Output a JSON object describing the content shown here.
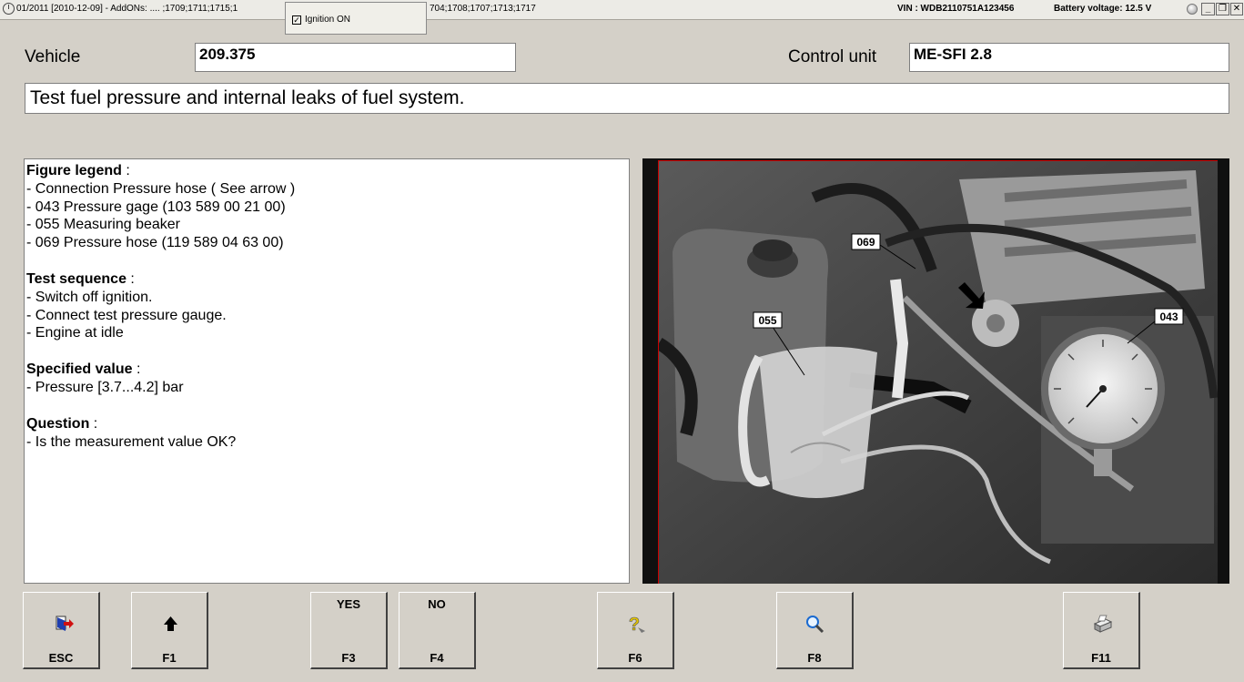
{
  "titlebar": {
    "left_text": "01/2011 [2010-12-09] - AddONs: .... ;1709;1711;1715;1",
    "right_fragment": "704;1708;1707;1713;1717",
    "ignition_label": "Ignition ON",
    "vin": "VIN : WDB2110751A123456",
    "battery": "Battery voltage: 12.5 V",
    "minimize": "_",
    "restore": "❐",
    "close": "✕"
  },
  "vehicle": {
    "label": "Vehicle",
    "value": "209.375"
  },
  "control_unit": {
    "label": "Control unit",
    "value": "ME-SFI 2.8"
  },
  "header": "Test fuel pressure and internal leaks of fuel system.",
  "sections": [
    {
      "title": "Figure legend",
      "items": [
        "- Connection Pressure hose ( See arrow )",
        "- 043 Pressure gage (103 589 00 21 00)",
        "- 055 Measuring beaker",
        "- 069 Pressure hose (119 589 04 63 00)"
      ]
    },
    {
      "title": "Test sequence",
      "items": [
        "- Switch off ignition.",
        "- Connect test pressure gauge.",
        "- Engine at idle"
      ]
    },
    {
      "title": "Specified value",
      "items": [
        "- Pressure [3.7...4.2] bar"
      ]
    },
    {
      "title": "Question",
      "items": [
        "- Is the measurement value OK?"
      ]
    }
  ],
  "section_separator": ":",
  "figure_labels": {
    "l069": "069",
    "l055": "055",
    "l043": "043"
  },
  "fkeys": [
    {
      "key": "ESC",
      "top": "",
      "icon": "exit-door-icon"
    },
    {
      "key": "F1",
      "top": "",
      "icon": "up-arrow-icon"
    },
    {
      "key": "F3",
      "top": "YES",
      "icon": ""
    },
    {
      "key": "F4",
      "top": "NO",
      "icon": ""
    },
    {
      "key": "F6",
      "top": "",
      "icon": "help-question-icon"
    },
    {
      "key": "F8",
      "top": "",
      "icon": "magnifier-icon"
    },
    {
      "key": "F11",
      "top": "",
      "icon": "printer-icon"
    }
  ]
}
